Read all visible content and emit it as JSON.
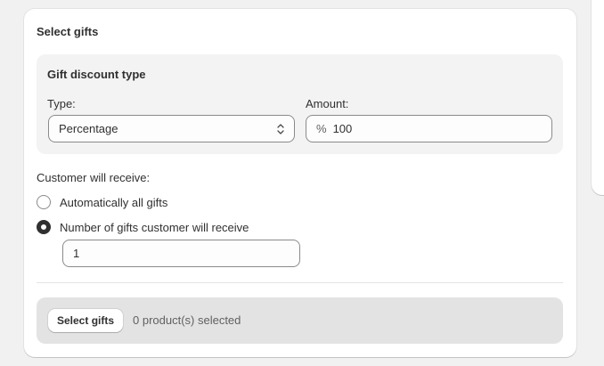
{
  "card": {
    "title": "Select gifts"
  },
  "discount_panel": {
    "title": "Gift discount type",
    "type_label": "Type:",
    "type_value": "Percentage",
    "amount_label": "Amount:",
    "amount_prefix": "%",
    "amount_value": "100"
  },
  "receive": {
    "label": "Customer will receive:",
    "options": [
      {
        "label": "Automatically all gifts",
        "checked": false
      },
      {
        "label": "Number of gifts customer will receive",
        "checked": true
      }
    ],
    "count_value": "1"
  },
  "footer": {
    "button_label": "Select gifts",
    "selected_text": "0 product(s) selected"
  },
  "icons": {
    "select_chevron": "chevron-up-down-icon"
  },
  "colors": {
    "page_bg": "#f1f1f1",
    "card_bg": "#ffffff",
    "panel_bg": "#f3f3f3",
    "footer_bg": "#e3e3e3",
    "text": "#303030"
  }
}
